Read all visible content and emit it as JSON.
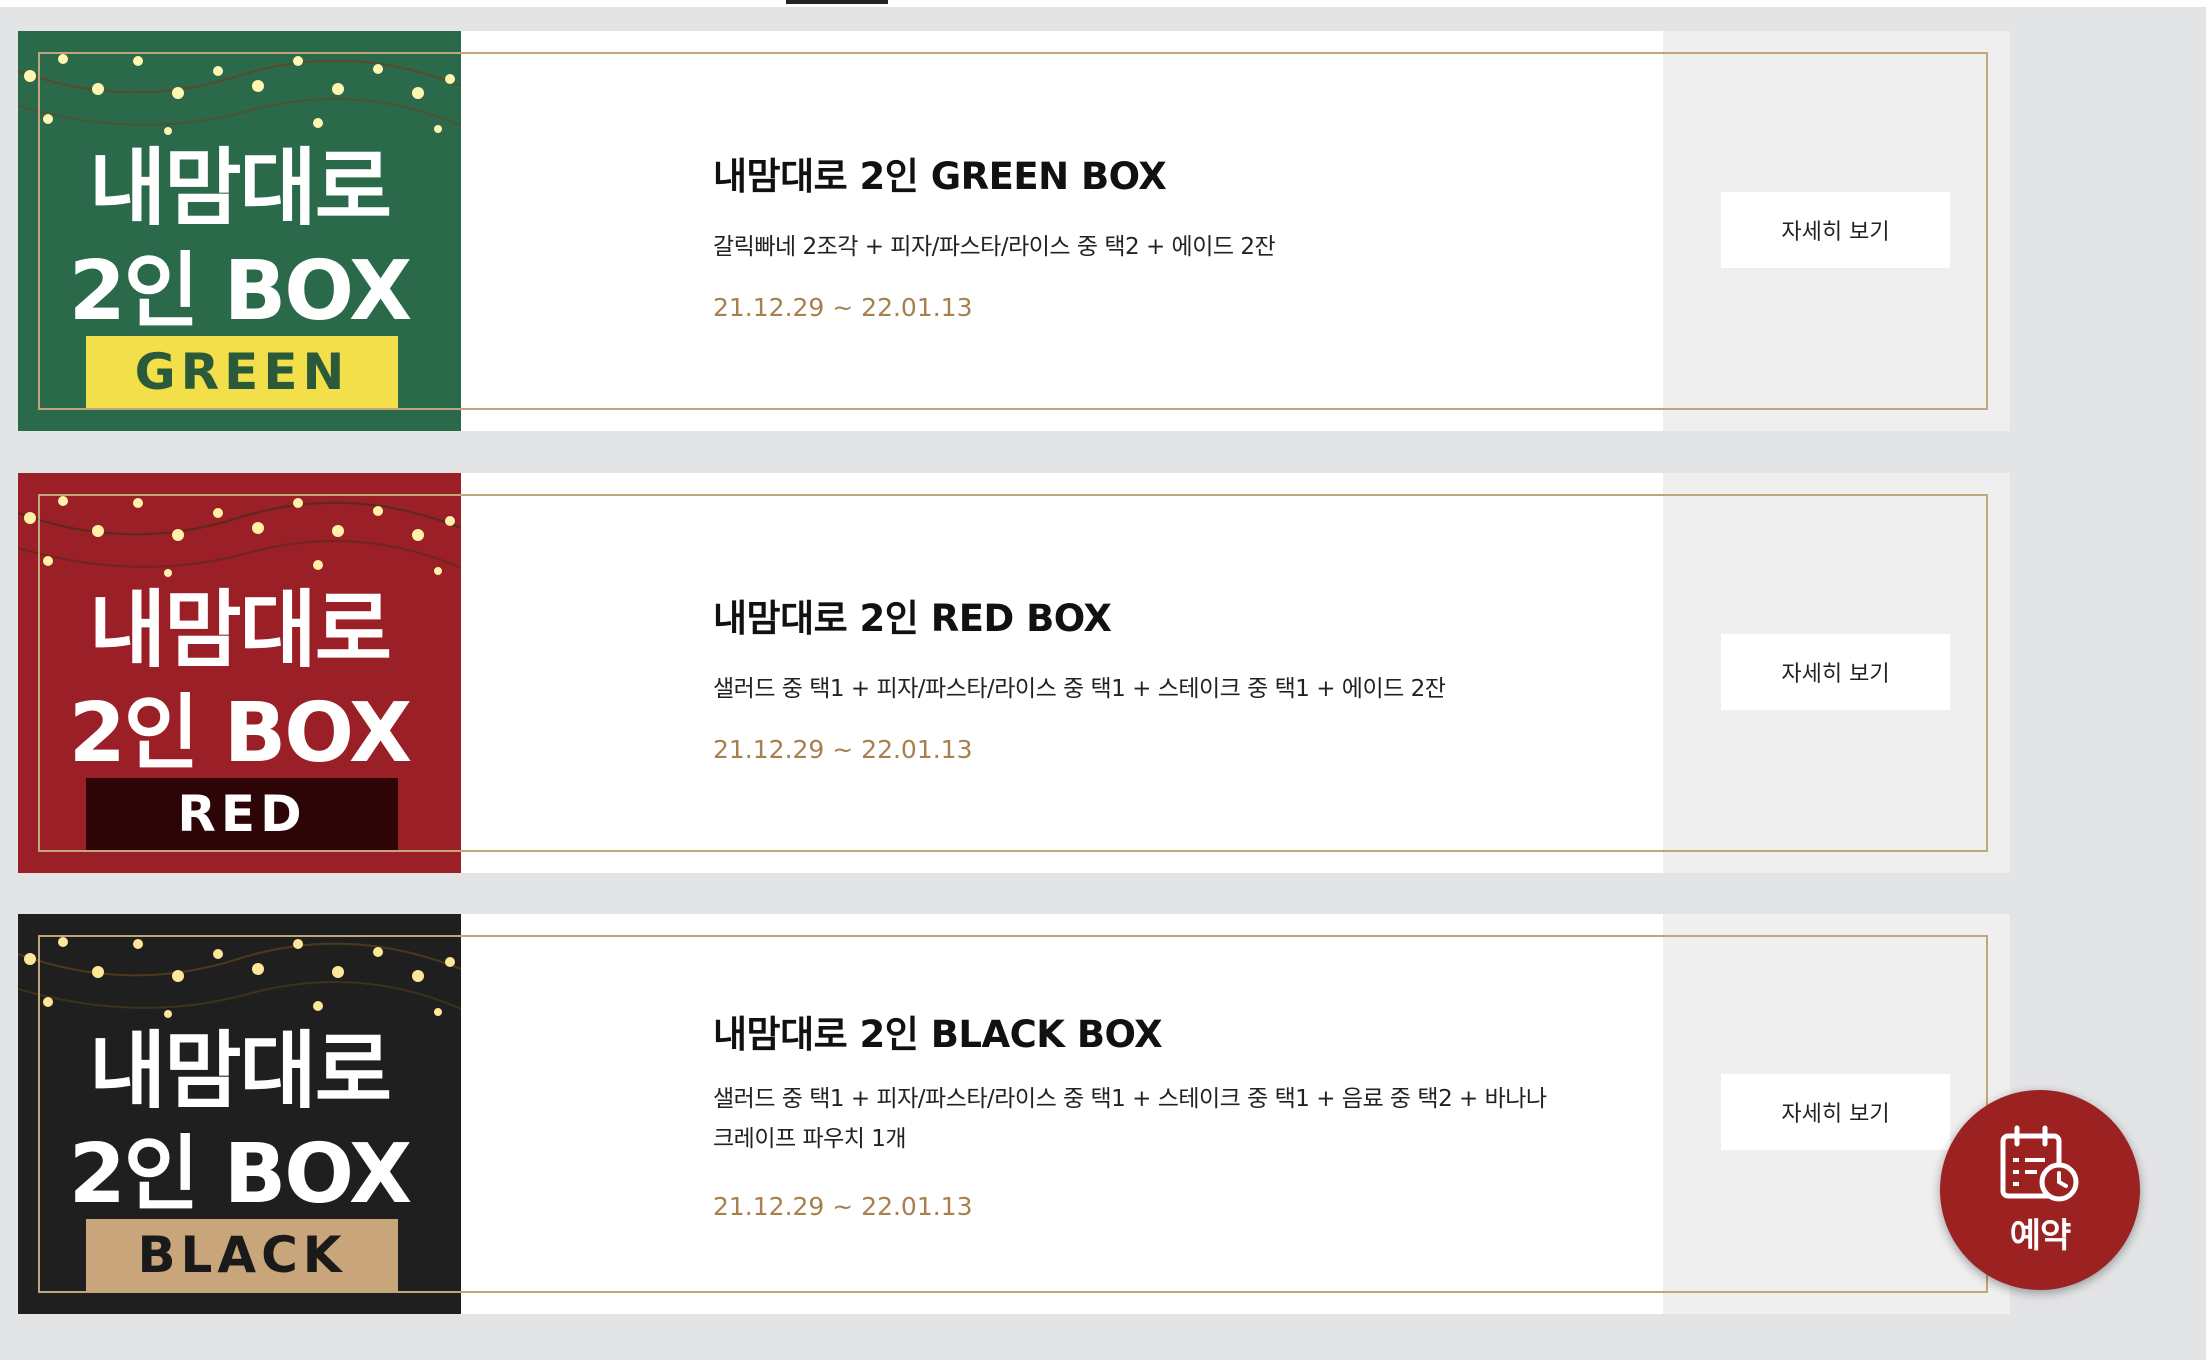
{
  "colors": {
    "page_background": "#e3e4e6",
    "frame_gold": "#c1a57b",
    "period_text": "#a8804e",
    "fab_red": "#9c2222"
  },
  "products": [
    {
      "id": "green",
      "title": "내맘대로 2인 GREEN BOX",
      "description": "갈릭빠네 2조각 + 피자/파스타/라이스 중 택2 + 에이드 2잔",
      "period": "21.12.29 ~ 22.01.13",
      "detail_label": "자세히 보기",
      "thumbnail": {
        "line1": "내맘대로",
        "line2": "2인 BOX",
        "tag": "GREEN",
        "bg_color": "#2a6a4b",
        "tag_bg": "#f3df4a",
        "tag_text_color": "#2a5a3b"
      }
    },
    {
      "id": "red",
      "title": "내맘대로 2인 RED BOX",
      "description": "샐러드 중 택1 + 피자/파스타/라이스 중 택1 + 스테이크 중 택1 + 에이드 2잔",
      "period": "21.12.29 ~ 22.01.13",
      "detail_label": "자세히 보기",
      "thumbnail": {
        "line1": "내맘대로",
        "line2": "2인 BOX",
        "tag": "RED",
        "bg_color": "#9b1f26",
        "tag_bg": "#2d0507",
        "tag_text_color": "#ffffff"
      }
    },
    {
      "id": "black",
      "title": "내맘대로 2인 BLACK BOX",
      "description": "샐러드 중 택1 + 피자/파스타/라이스 중 택1 + 스테이크 중 택1 + 음료 중 택2 + 바나나 크레이프 파우치 1개",
      "period": "21.12.29 ~ 22.01.13",
      "detail_label": "자세히 보기",
      "thumbnail": {
        "line1": "내맘대로",
        "line2": "2인 BOX",
        "tag": "BLACK",
        "bg_color": "#1f1f1f",
        "tag_bg": "#c9a57c",
        "tag_text_color": "#1a1a1a"
      }
    }
  ],
  "reserve_button": {
    "label": "예약",
    "icon": "calendar-clock-icon"
  }
}
